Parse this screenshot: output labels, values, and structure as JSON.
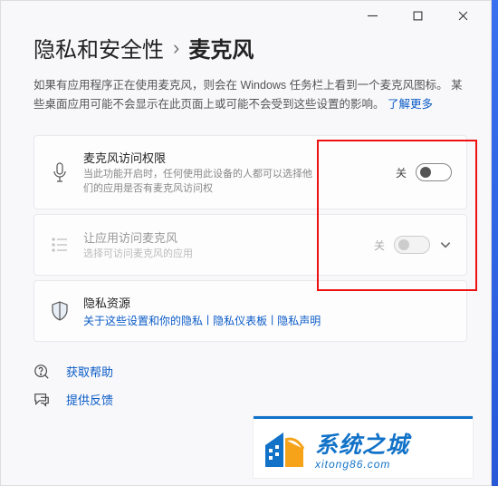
{
  "titlebar": {
    "min": "—",
    "max": "▢",
    "close": "✕"
  },
  "breadcrumb": {
    "parent": "隐私和安全性",
    "sep": "›",
    "current": "麦克风"
  },
  "description": {
    "text_before": "如果有应用程序正在使用麦克风，则会在 Windows 任务栏上看到一个麦克风图标。 某些桌面应用可能不会显示在此页面上或可能不会受到这些设置的影响。 ",
    "link": "了解更多"
  },
  "rows": {
    "mic_access": {
      "title": "麦克风访问权限",
      "sub": "当此功能开启时，任何使用此设备的人都可以选择他们的应用是否有麦克风访问权",
      "toggle_label": "关"
    },
    "app_access": {
      "title": "让应用访问麦克风",
      "sub": "选择可访问麦克风的应用",
      "toggle_label": "关"
    },
    "privacy_res": {
      "title": "隐私资源",
      "links": [
        "关于这些设置和你的隐私",
        "隐私仪表板",
        "隐私声明"
      ]
    }
  },
  "footer": {
    "help": "获取帮助",
    "feedback": "提供反馈"
  },
  "watermark": {
    "zh": "系统之城",
    "url": "xitong86.com"
  }
}
